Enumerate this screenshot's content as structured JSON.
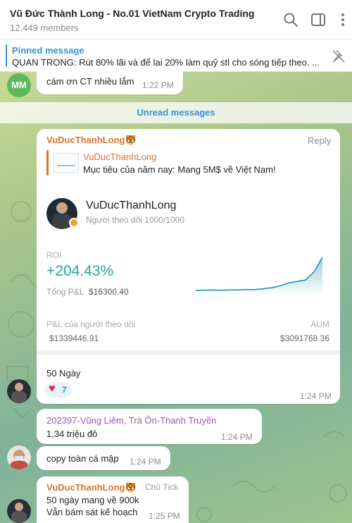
{
  "header": {
    "title": "Vũ Đức Thành Long - No.01 VietNam Crypto Trading",
    "members": "12,449 members",
    "icons": [
      "search-icon",
      "sidebar-icon",
      "more-icon"
    ]
  },
  "pinned": {
    "label": "Pinned message",
    "text": "QUAN TRỌNG: Rút 80% lãi và để lại 20% làm quỹ stl cho sóng tiếp theo. ..."
  },
  "messages": {
    "m0": {
      "avatar": "MM",
      "avatar_color": "#5eb85c",
      "text": "cám ơn CT nhiều lắm",
      "time": "1:22 PM"
    },
    "unread": "Unread messages",
    "m1": {
      "sender": "VuDucThanhLong🐯",
      "sender_color": "#d9742a",
      "reply_label": "Reply",
      "quote_sender": "VuDucThanhLong",
      "quote_text": "Mục tiêu của năm nay:  Mang 5M$ về Việt Nam!",
      "card": {
        "name": "VuDucThanhLong",
        "followers": "Người theo dõi 1000/1000",
        "roi_label": "ROI",
        "roi_value": "+204.43%",
        "pnl_label": "Tổng P&L",
        "pnl_value": "$16300.40",
        "follower_pnl_label": "P&L của người theo dõi",
        "follower_pnl_value": "$1339446.91",
        "aum_label": "AUM",
        "aum_value": "$3091768.36"
      },
      "text": "50 Ngày",
      "reaction_emoji": "♥",
      "reaction_count": "7",
      "time": "1:24 PM"
    },
    "m2": {
      "sender": "202397-Vũng Liêm, Trà Ôn-Thanh Truyền",
      "sender_color": "#9b59b6",
      "text": "1,34 triệu đô",
      "time": "1:24 PM"
    },
    "m3": {
      "text": "copy toàn cá mập",
      "time": "1:24 PM"
    },
    "m4": {
      "sender": "VuDucThanhLong🐯",
      "sender_color": "#d9742a",
      "badge": "Chủ Tịck",
      "line1": "50 ngày mang về 900k",
      "line2": "Vẫn bám sát kế hoạch",
      "time": "1:25 PM"
    }
  },
  "chart_data": {
    "type": "area",
    "values": [
      0.1,
      0.1,
      0.11,
      0.1,
      0.11,
      0.11,
      0.12,
      0.12,
      0.14,
      0.17,
      0.22,
      0.3,
      0.34,
      0.38,
      0.6,
      1.0
    ]
  },
  "colors": {
    "accent": "#3a8fd9",
    "roi_green": "#1fa88f",
    "chart_line": "#1e96a8"
  }
}
